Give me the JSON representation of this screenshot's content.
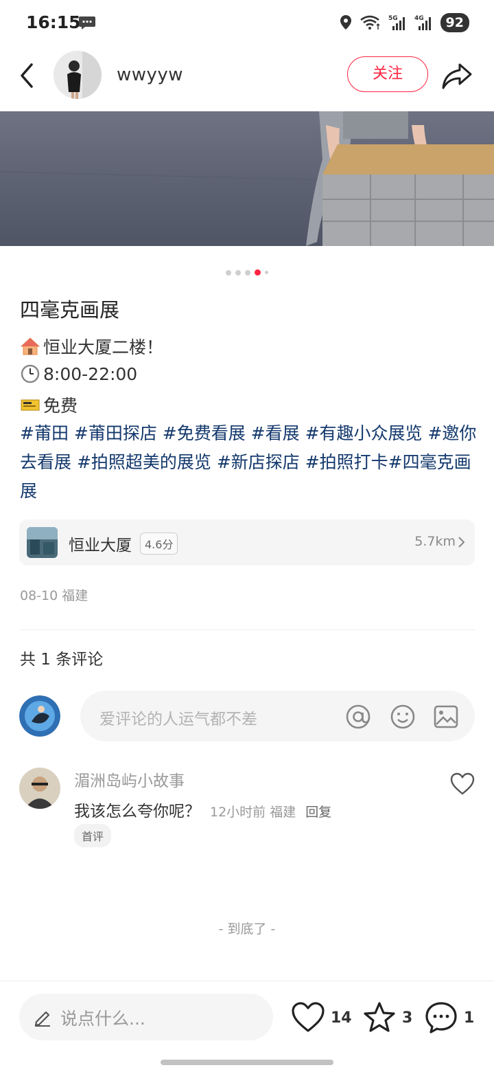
{
  "status_bar": {
    "time": "16:15",
    "battery": "92",
    "icons": [
      "message-icon",
      "location-icon",
      "wifi-icon",
      "signal-5g-icon",
      "signal-4g-icon"
    ],
    "net_5g": "5G",
    "net_4g": "4G"
  },
  "header": {
    "username": "wwyyw",
    "follow_label": "关注"
  },
  "carousel": {
    "count": 5,
    "active_index": 3
  },
  "post": {
    "title": "四毫克画展",
    "line1": "恒业大厦二楼！",
    "line2": "8:00-22:00",
    "line3": "免费",
    "hashtags": "#莆田 #莆田探店 #免费看展 #看展 #有趣小众展览 #邀你去看展 #拍照超美的展览 #新店探店 #拍照打卡#四毫克画展"
  },
  "location": {
    "name": "恒业大厦",
    "score": "4.6分",
    "distance": "5.7km"
  },
  "meta": {
    "date": "08-10 福建"
  },
  "comments_section": {
    "count_label": "共 1 条评论",
    "input_placeholder": "爱评论的人运气都不差"
  },
  "comment": {
    "author": "湄洲岛屿小故事",
    "text": "我该怎么夸你呢？",
    "meta": "12小时前 福建",
    "reply": "回复",
    "badge": "首评"
  },
  "end_text": "- 到底了 -",
  "bottom_bar": {
    "placeholder": "说点什么...",
    "likes": "14",
    "collects": "3",
    "comments": "1"
  },
  "colors": {
    "accent": "#ff2442",
    "hashtag": "#13386c"
  }
}
